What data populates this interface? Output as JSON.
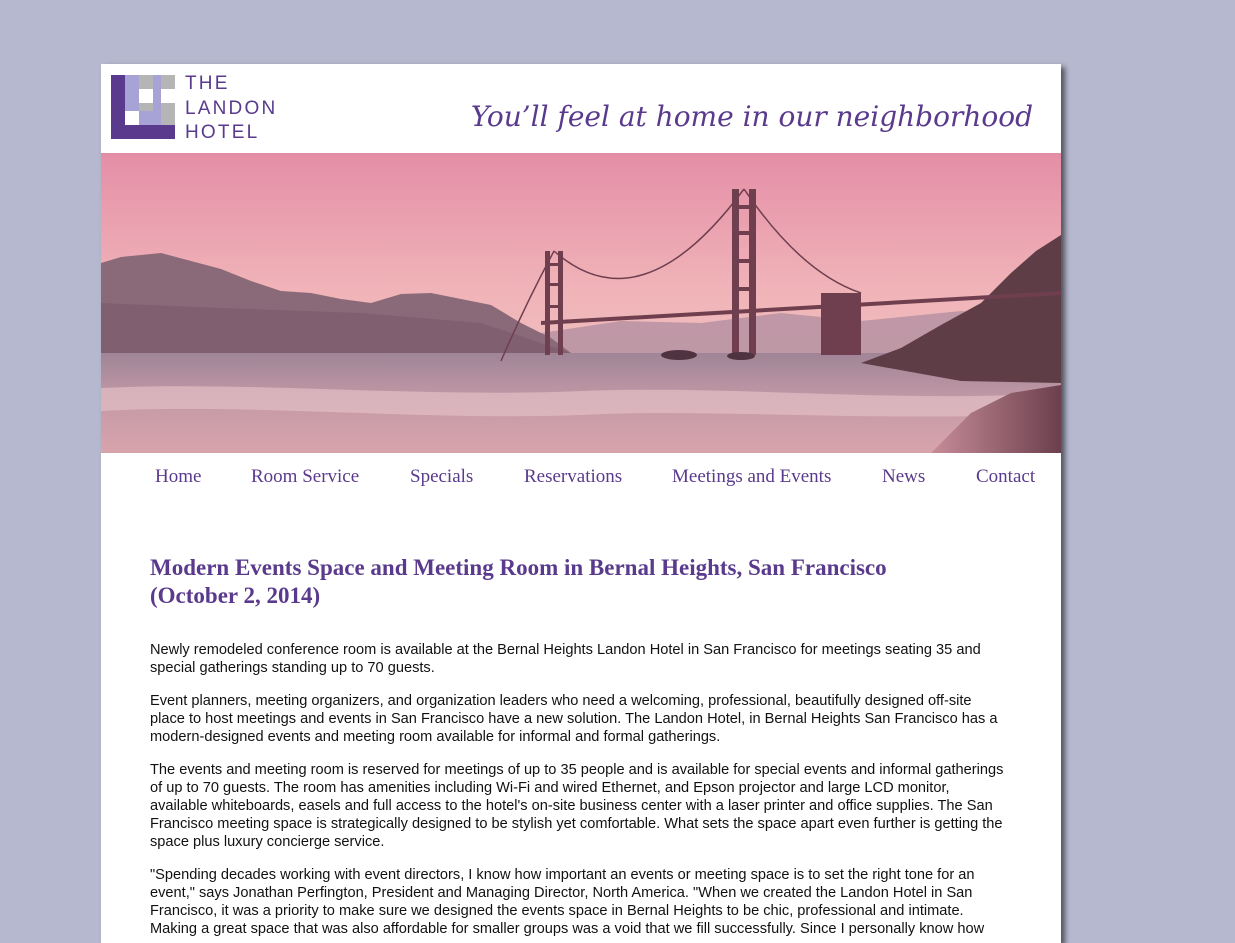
{
  "brand": {
    "logo_lines": [
      "THE",
      "LANDON",
      "HOTEL"
    ],
    "tagline": "You’ll feel at home in our neighborhood",
    "colors": {
      "purple": "#5a3a8c",
      "lavender": "#a8a3d6",
      "gray": "#b5b5b5",
      "backdrop": "#b6b8cf"
    }
  },
  "hero": {
    "image": "golden-gate-bridge-sunset-photo"
  },
  "nav": {
    "items": [
      {
        "label": "Home"
      },
      {
        "label": "Room Service"
      },
      {
        "label": "Specials"
      },
      {
        "label": "Reservations"
      },
      {
        "label": "Meetings and Events"
      },
      {
        "label": "News"
      },
      {
        "label": "Contact"
      }
    ]
  },
  "article": {
    "title_line1": "Modern Events Space and Meeting Room in Bernal Heights, San Francisco",
    "title_line2": "(October 2, 2014)",
    "paragraphs": [
      {
        "lines": [
          "Newly remodeled conference room is available at the Bernal Heights Landon Hotel in San Francisco for meetings seating 35 and",
          "special gatherings standing up to 70 guests."
        ]
      },
      {
        "lines": [
          "Event planners, meeting organizers, and organization leaders who need a welcoming, professional, beautifully designed off-site",
          "place to host meetings and events in San Francisco have a new solution. The Landon Hotel, in Bernal Heights San Francisco has a",
          "modern-designed events and meeting room available for informal and formal gatherings."
        ]
      },
      {
        "lines": [
          "The events and meeting room is reserved for meetings of up to 35 people and is available for special events and informal gatherings",
          "of up to 70 guests. The room has amenities including Wi-Fi and wired Ethernet, and Epson projector and large LCD monitor,",
          "available whiteboards, easels and full access to the hotel's on-site business center with a laser printer and office supplies. The San",
          "Francisco meeting space is strategically designed to be stylish yet comfortable. What sets the space apart even further is getting the",
          "space plus luxury concierge service."
        ]
      },
      {
        "lines": [
          "\"Spending decades working with event directors, I know how important an events or meeting space is to set the right tone for an",
          "event,\" says Jonathan Perfington, President and Managing Director, North America. \"When we created the Landon Hotel in San",
          "Francisco, it was a priority to make sure we designed the events space in Bernal Heights to be chic, professional and intimate.",
          "Making a great space that was also affordable for smaller groups was a void that we fill successfully. Since I personally know how"
        ]
      }
    ]
  }
}
